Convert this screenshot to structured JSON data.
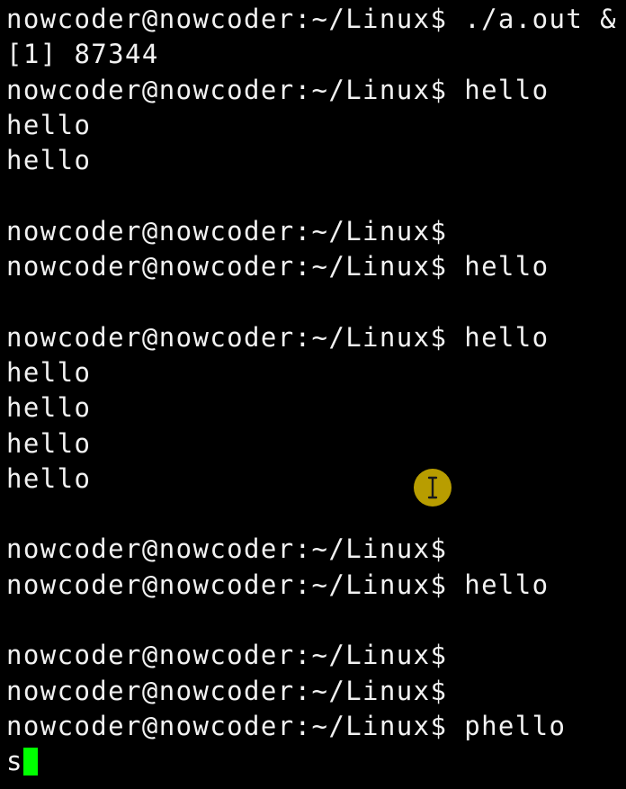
{
  "terminal": {
    "lines": [
      "nowcoder@nowcoder:~/Linux$ ./a.out &",
      "[1] 87344",
      "nowcoder@nowcoder:~/Linux$ hello",
      "hello",
      "hello",
      "",
      "nowcoder@nowcoder:~/Linux$",
      "nowcoder@nowcoder:~/Linux$ hello",
      "",
      "nowcoder@nowcoder:~/Linux$ hello",
      "hello",
      "hello",
      "hello",
      "hello",
      "",
      "nowcoder@nowcoder:~/Linux$",
      "nowcoder@nowcoder:~/Linux$ hello",
      "",
      "nowcoder@nowcoder:~/Linux$",
      "nowcoder@nowcoder:~/Linux$",
      "nowcoder@nowcoder:~/Linux$ phello"
    ],
    "input_text": "s",
    "cursor_color": "#00ff00"
  },
  "colors": {
    "background": "#000000",
    "foreground": "#f2f2f2",
    "mouse_highlight": "#c8aa00"
  },
  "icons": {
    "pointer": "ibeam-cursor-icon"
  }
}
